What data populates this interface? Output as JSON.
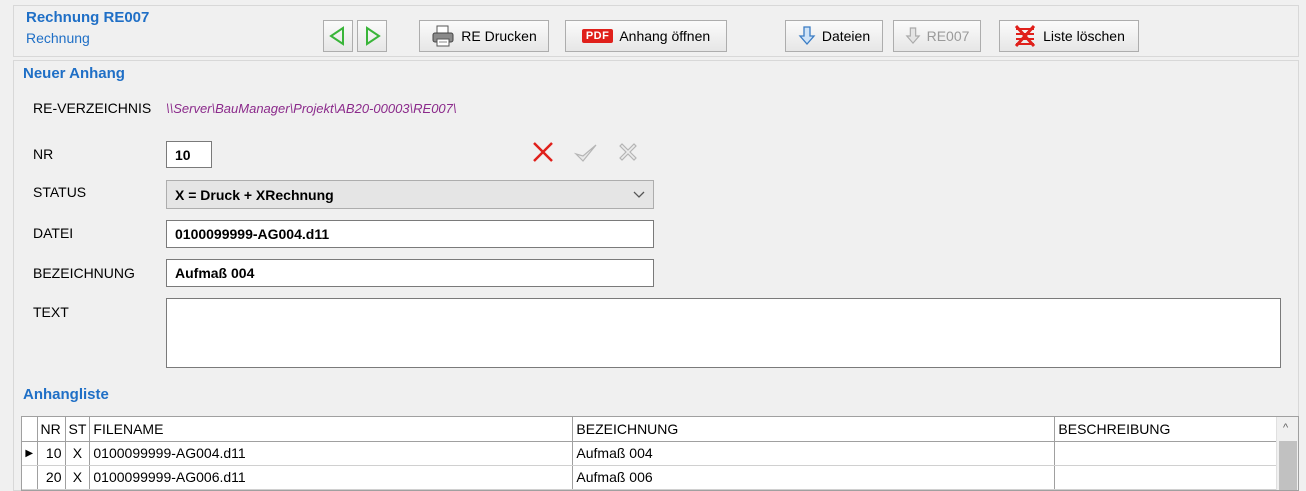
{
  "header": {
    "title": "Rechnung RE007",
    "subtitle": "Rechnung"
  },
  "toolbar": {
    "print_label": "RE Drucken",
    "pdf_badge": "PDF",
    "open_attachment_label": "Anhang öffnen",
    "files_label": "Dateien",
    "re_label": "RE007",
    "clear_list_label": "Liste löschen"
  },
  "form": {
    "section_title": "Neuer Anhang",
    "directory_label": "RE-VERZEICHNIS",
    "directory_value": "\\\\Server\\BauManager\\Projekt\\AB20-00003\\RE007\\",
    "nr_label": "NR",
    "nr_value": "10",
    "status_label": "STATUS",
    "status_value": "X = Druck + XRechnung",
    "datei_label": "DATEI",
    "datei_value": "0100099999-AG004.d11",
    "bezeichnung_label": "BEZEICHNUNG",
    "bezeichnung_value": "Aufmaß 004",
    "text_label": "TEXT",
    "text_value": ""
  },
  "list": {
    "section_title": "Anhangliste",
    "columns": [
      "NR",
      "ST",
      "FILENAME",
      "BEZEICHNUNG",
      "BESCHREIBUNG"
    ],
    "rows": [
      {
        "nr": "10",
        "st": "X",
        "filename": "0100099999-AG004.d11",
        "bezeichnung": "Aufmaß 004",
        "beschreibung": ""
      },
      {
        "nr": "20",
        "st": "X",
        "filename": "0100099999-AG006.d11",
        "bezeichnung": "Aufmaß 006",
        "beschreibung": ""
      }
    ]
  },
  "colors": {
    "accent_blue": "#1f6fc6",
    "path_purple": "#8b2a8b",
    "delete_red": "#e0201b",
    "arrow_green": "#3ab53a"
  },
  "icons": {
    "prev": "arrow-left-icon",
    "next": "arrow-right-icon",
    "print": "printer-icon",
    "files": "download-arrow-icon",
    "clear": "clear-list-icon",
    "delete": "delete-x-icon",
    "confirm": "checkmark-icon",
    "cancel": "cancel-icon"
  }
}
